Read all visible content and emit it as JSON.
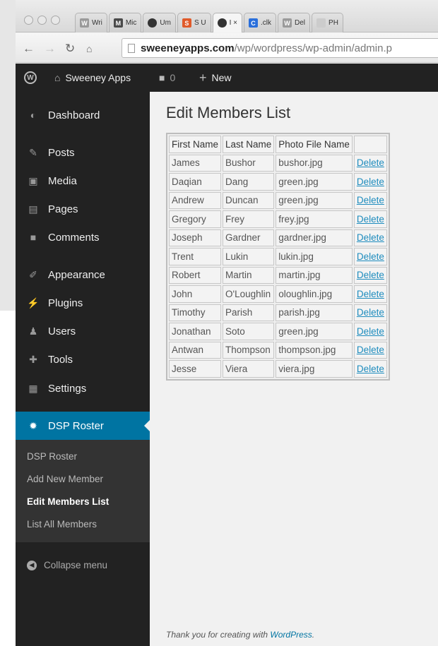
{
  "browser": {
    "tabs": [
      {
        "icon": "wordpress-icon",
        "icon_text": "W",
        "icon_color": "#9a9a9a",
        "label": "Wri",
        "active": false
      },
      {
        "icon": "mic-icon",
        "icon_text": "M",
        "icon_color": "#4a4a4a",
        "label": "Mic",
        "active": false
      },
      {
        "icon": "globe-icon",
        "icon_text": "",
        "icon_color": "#333333",
        "label": "Um",
        "active": false
      },
      {
        "icon": "s-icon",
        "icon_text": "S",
        "icon_color": "#e05a2a",
        "label": "S U",
        "active": false
      },
      {
        "icon": "globe-icon",
        "icon_text": "",
        "icon_color": "#333333",
        "label": "I ×",
        "active": true
      },
      {
        "icon": "c-icon",
        "icon_text": "C",
        "icon_color": "#2a6fdb",
        "label": ".clk",
        "active": false
      },
      {
        "icon": "wordpress-icon",
        "icon_text": "W",
        "icon_color": "#9a9a9a",
        "label": "Del",
        "active": false
      },
      {
        "icon": "page-icon",
        "icon_text": "",
        "icon_color": "#cccccc",
        "label": "PH",
        "active": false
      }
    ],
    "url_host": "sweeneyapps.com",
    "url_path": "/wp/wordpress/wp-admin/admin.p"
  },
  "adminbar": {
    "site_name": "Sweeney Apps",
    "comments_count": "0",
    "new_label": "New"
  },
  "sidebar": {
    "items": [
      {
        "name": "dashboard",
        "label": "Dashboard",
        "icon": "dashboard-icon"
      },
      {
        "name": "posts",
        "label": "Posts",
        "icon": "pin-icon"
      },
      {
        "name": "media",
        "label": "Media",
        "icon": "media-icon"
      },
      {
        "name": "pages",
        "label": "Pages",
        "icon": "pages-icon"
      },
      {
        "name": "comments",
        "label": "Comments",
        "icon": "comment-icon"
      },
      {
        "name": "appearance",
        "label": "Appearance",
        "icon": "brush-icon"
      },
      {
        "name": "plugins",
        "label": "Plugins",
        "icon": "plug-icon"
      },
      {
        "name": "users",
        "label": "Users",
        "icon": "users-icon"
      },
      {
        "name": "tools",
        "label": "Tools",
        "icon": "wrench-icon"
      },
      {
        "name": "settings",
        "label": "Settings",
        "icon": "settings-icon"
      },
      {
        "name": "dsp-roster",
        "label": "DSP Roster",
        "icon": "gear-icon",
        "current": true
      }
    ],
    "submenu": [
      {
        "label": "DSP Roster"
      },
      {
        "label": "Add New Member"
      },
      {
        "label": "Edit Members List",
        "current": true
      },
      {
        "label": "List All Members"
      }
    ],
    "collapse_label": "Collapse menu"
  },
  "main": {
    "title": "Edit Members List",
    "table": {
      "headers": [
        "First Name",
        "Last Name",
        "Photo File Name",
        ""
      ],
      "delete_label": "Delete",
      "rows": [
        [
          "James",
          "Bushor",
          "bushor.jpg"
        ],
        [
          "Daqian",
          "Dang",
          "green.jpg"
        ],
        [
          "Andrew",
          "Duncan",
          "green.jpg"
        ],
        [
          "Gregory",
          "Frey",
          "frey.jpg"
        ],
        [
          "Joseph",
          "Gardner",
          "gardner.jpg"
        ],
        [
          "Trent",
          "Lukin",
          "lukin.jpg"
        ],
        [
          "Robert",
          "Martin",
          "martin.jpg"
        ],
        [
          "John",
          "O'Loughlin",
          "oloughlin.jpg"
        ],
        [
          "Timothy",
          "Parish",
          "parish.jpg"
        ],
        [
          "Jonathan",
          "Soto",
          "green.jpg"
        ],
        [
          "Antwan",
          "Thompson",
          "thompson.jpg"
        ],
        [
          "Jesse",
          "Viera",
          "viera.jpg"
        ]
      ]
    },
    "footer_text": "Thank you for creating with ",
    "footer_link": "WordPress",
    "footer_end": "."
  },
  "colors": {
    "admin_dark": "#222222",
    "accent_blue": "#0074a2",
    "link_blue": "#1e8cbe",
    "content_bg": "#f1f1f1"
  }
}
